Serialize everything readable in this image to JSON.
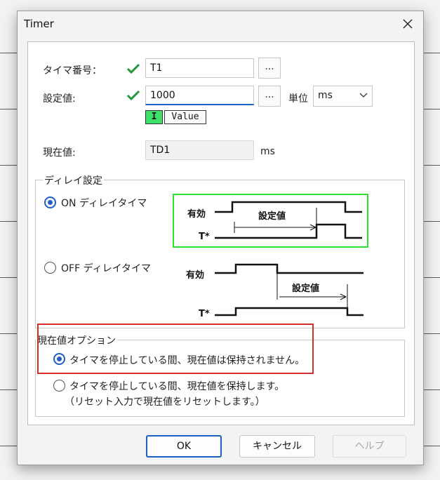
{
  "window": {
    "title": "Timer"
  },
  "form": {
    "timer_number_label": "タイマ番号：",
    "timer_number_value": "T1",
    "setting_label": "設定値:",
    "setting_value": "1000",
    "browse_label": "...",
    "unit_label": "単位",
    "unit_value": "ms",
    "ime_cursor": "I",
    "ime_mode": "Value",
    "current_label": "現在値:",
    "current_value": "TD1",
    "current_unit": "ms"
  },
  "delay_group": {
    "title": "ディレイ設定",
    "on_delay_label": "ON ディレイタイマ",
    "on_delay_selected": true,
    "off_delay_label": "OFF ディレイタイマ",
    "off_delay_selected": false,
    "on_diagram": {
      "enable": "有効",
      "setting": "設定値",
      "output": "T*"
    },
    "off_diagram": {
      "enable": "有効",
      "setting": "設定値",
      "output": "T*"
    }
  },
  "current_option_group": {
    "title": "現在値オプション",
    "option_not_keep": "タイマを停止している間、現在値は保持されません。",
    "option_not_keep_selected": true,
    "option_keep": "タイマを停止している間、現在値を保持します。",
    "option_keep_note": "（リセット入力で現在値をリセットします。）",
    "option_keep_selected": false
  },
  "buttons": {
    "ok": "OK",
    "cancel": "キャンセル",
    "help": "ヘルプ"
  },
  "colors": {
    "accent": "#1d5fc4",
    "check": "#1e9a3a",
    "red_box": "#d62b2b",
    "green_box": "#2ee02e"
  }
}
